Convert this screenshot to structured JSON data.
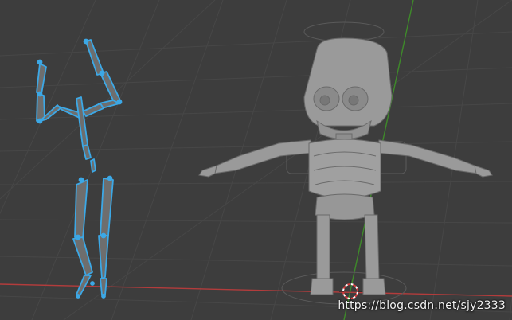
{
  "viewport": {
    "background": "#3d3d3d",
    "grid_color": "#474747",
    "axis_x_color": "#b33c3c",
    "axis_y_color": "#3e8a2a"
  },
  "armature": {
    "selection_color": "#3ca8e6",
    "bone_fill": "#6e6e6e"
  },
  "mesh": {
    "color": "#9a9a9a",
    "shadow": "#6a6a6a"
  },
  "watermark": {
    "text": "https://blog.csdn.net/sjy2333"
  }
}
